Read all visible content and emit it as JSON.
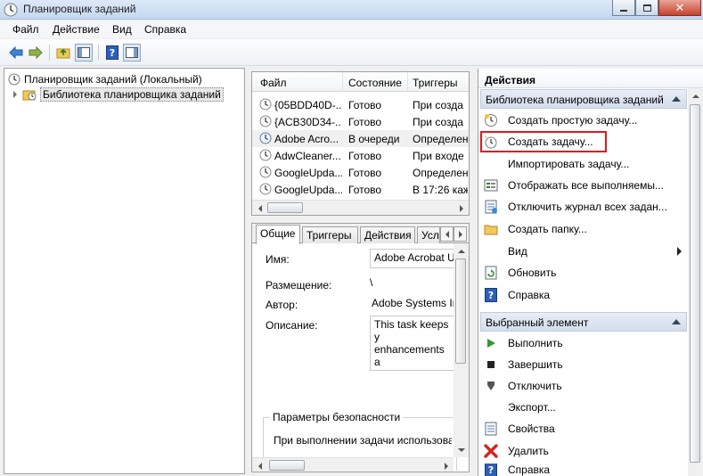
{
  "window": {
    "title": "Планировщик заданий"
  },
  "menu": [
    "Файл",
    "Действие",
    "Вид",
    "Справка"
  ],
  "tree": {
    "root": "Планировщик заданий (Локальный)",
    "library": "Библиотека планировщика заданий"
  },
  "task_list": {
    "columns": [
      "Файл",
      "Состояние",
      "Триггеры"
    ],
    "rows": [
      {
        "name": "{05BDD40D-...",
        "status": "Готово",
        "trigger": "При созда"
      },
      {
        "name": "{ACB30D34-...",
        "status": "Готово",
        "trigger": "При созда"
      },
      {
        "name": "Adobe Acro...",
        "status": "В очереди",
        "trigger": "Определен"
      },
      {
        "name": "AdwCleaner...",
        "status": "Готово",
        "trigger": "При входе"
      },
      {
        "name": "GoogleUpda...",
        "status": "Готово",
        "trigger": "Определен"
      },
      {
        "name": "GoogleUpda...",
        "status": "Готово",
        "trigger": "В 17:26 кажд"
      }
    ]
  },
  "details": {
    "tabs": [
      "Общие",
      "Триггеры",
      "Действия",
      "Усл"
    ],
    "name_label": "Имя:",
    "name_value": "Adobe Acrobat U",
    "location_label": "Размещение:",
    "location_value": "\\",
    "author_label": "Автор:",
    "author_value": "Adobe Systems In",
    "description_label": "Описание:",
    "description_line1": "This task keeps y",
    "description_line2": "enhancements a",
    "security_group": "Параметры безопасности",
    "security_text": "При выполнении задачи использова"
  },
  "actions": {
    "title": "Действия",
    "section1": "Библиотека планировщика заданий",
    "items1": [
      {
        "label": "Создать простую задачу...",
        "icon": "wizard-icon"
      },
      {
        "label": "Создать задачу...",
        "icon": "new-task-icon"
      },
      {
        "label": "Импортировать задачу...",
        "icon": "none"
      },
      {
        "label": "Отображать все выполняемы...",
        "icon": "running-tasks-icon"
      },
      {
        "label": "Отключить журнал всех задан...",
        "icon": "history-icon"
      },
      {
        "label": "Создать папку...",
        "icon": "folder-icon"
      },
      {
        "label": "Вид",
        "icon": "none"
      },
      {
        "label": "Обновить",
        "icon": "refresh-icon"
      },
      {
        "label": "Справка",
        "icon": "help-icon"
      }
    ],
    "section2": "Выбранный элемент",
    "items2": [
      {
        "label": "Выполнить",
        "icon": "run-icon"
      },
      {
        "label": "Завершить",
        "icon": "stop-icon"
      },
      {
        "label": "Отключить",
        "icon": "disable-icon"
      },
      {
        "label": "Экспорт...",
        "icon": "none"
      },
      {
        "label": "Свойства",
        "icon": "properties-icon"
      },
      {
        "label": "Удалить",
        "icon": "delete-icon"
      },
      {
        "label": "Справка",
        "icon": "help-icon"
      }
    ]
  },
  "colors": {
    "highlight_border": "#e0191e",
    "section_header": "#d3dded"
  }
}
